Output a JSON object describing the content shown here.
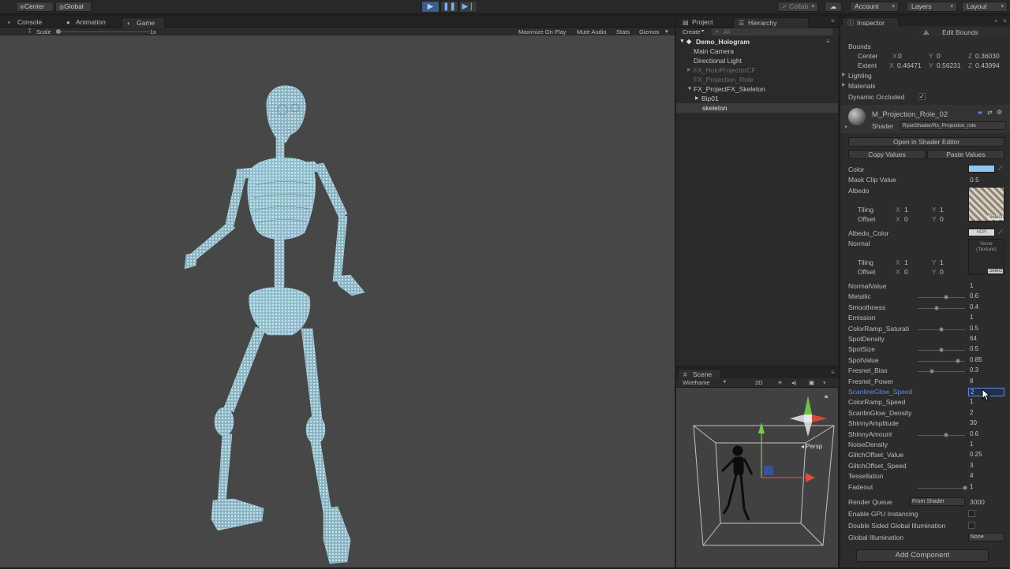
{
  "toolbar": {
    "pivot": "Center",
    "space": "Global",
    "collab": "Collab",
    "account": "Account",
    "layers": "Layers",
    "layout": "Layout"
  },
  "left_tabs": [
    {
      "label": "Console",
      "icon": "console-icon"
    },
    {
      "label": "Animation",
      "icon": "animation-icon"
    },
    {
      "label": "Game",
      "icon": "game-icon"
    }
  ],
  "game": {
    "scale_label": "Scale",
    "scale_value": "1x",
    "maximize": "Maximize On Play",
    "mute": "Mute Audio",
    "stats": "Stats",
    "gizmos": "Gizmos"
  },
  "mid_tabs": [
    {
      "label": "Project",
      "icon": "project-icon"
    },
    {
      "label": "Hierarchy",
      "icon": "hierarchy-icon"
    }
  ],
  "hierarchy": {
    "create": "Create",
    "search_placeholder": "All",
    "scene_name": "Demo_Hologram",
    "items": [
      {
        "label": "Main Camera",
        "dim": false,
        "arrow": ""
      },
      {
        "label": "Directional Light",
        "dim": false,
        "arrow": ""
      },
      {
        "label": "FX_HoloProjectorCF",
        "dim": true,
        "arrow": "▶"
      },
      {
        "label": "FX_Projection_Role",
        "dim": true,
        "arrow": ""
      },
      {
        "label": "FX_ProjectFX_Skeleton",
        "dim": false,
        "arrow": "▼"
      },
      {
        "label": "Bip01",
        "dim": false,
        "arrow": "▶"
      },
      {
        "label": "skeleton",
        "dim": false,
        "arrow": ""
      }
    ]
  },
  "scene": {
    "tab": "Scene",
    "mode": "Wireframe",
    "dim": "2D",
    "persp": "Persp"
  },
  "inspector": {
    "tab": "Inspector",
    "edit_bounds": "Edit Bounds",
    "bounds_label": "Bounds",
    "center_label": "Center",
    "center": {
      "x": "0",
      "y": "0",
      "z": "0.36030"
    },
    "extent_label": "Extent",
    "extent": {
      "x": "0.46471",
      "y": "0.56231",
      "z": "0.43994"
    },
    "lighting": "Lighting",
    "materials": "Materials",
    "dynamic_occluded": "Dynamic Occluded",
    "material_name": "M_Projection_Role_02",
    "shader_label": "Shader",
    "shader_value": "RyanShader/Rs_Projection_role",
    "open_shader_editor": "Open in Shader Editor",
    "copy_values": "Copy Values",
    "paste_values": "Paste Values",
    "color_label": "Color",
    "mask_clip_label": "Mask Clip Value",
    "mask_clip_value": "0.5",
    "albedo_label": "Albedo",
    "tiling_label": "Tiling",
    "offset_label": "Offset",
    "tiling1": {
      "x": "1",
      "y": "1"
    },
    "offset1": {
      "x": "0",
      "y": "0"
    },
    "select": "Select",
    "albedo_color_label": "Albedo_Color",
    "hdr": "HDR",
    "normal_label": "Normal",
    "none_texture": "None (Texture)",
    "tiling2": {
      "x": "1",
      "y": "1"
    },
    "offset2": {
      "x": "0",
      "y": "0"
    },
    "properties": [
      {
        "label": "NormalValue",
        "value": "1",
        "slider": null
      },
      {
        "label": "Metallic",
        "value": "0.6",
        "slider": 0.6
      },
      {
        "label": "Smoothness",
        "value": "0.4",
        "slider": 0.4
      },
      {
        "label": "Emission",
        "value": "1",
        "slider": null
      },
      {
        "label": "ColorRamp_Saturati",
        "value": "0.5",
        "slider": 0.5
      },
      {
        "label": "SpotDensity",
        "value": "64",
        "slider": null
      },
      {
        "label": "SpotSize",
        "value": "0.5",
        "slider": 0.5
      },
      {
        "label": "SpotValue",
        "value": "0.85",
        "slider": 0.85
      },
      {
        "label": "Fresnel_Bias",
        "value": "0.3",
        "slider": 0.3
      },
      {
        "label": "Fresnel_Power",
        "value": "8",
        "slider": null
      },
      {
        "label": "ScanlineGlow_Speed",
        "value": "2",
        "slider": null,
        "active": true
      },
      {
        "label": "ColorRamp_Speed",
        "value": "1",
        "slider": null
      },
      {
        "label": "ScanlinGlow_Density",
        "value": "2",
        "slider": null
      },
      {
        "label": "ShinnyAmplitude",
        "value": "30",
        "slider": null
      },
      {
        "label": "ShinnyAmount",
        "value": "0.6",
        "slider": 0.6
      },
      {
        "label": "NoiseDensity",
        "value": "1",
        "slider": null
      },
      {
        "label": "GlitchOffset_Value",
        "value": "0.25",
        "slider": null
      },
      {
        "label": "GlitchOffset_Speed",
        "value": "3",
        "slider": null
      },
      {
        "label": "Tessellation",
        "value": "4",
        "slider": null
      },
      {
        "label": "Fadeout",
        "value": "1",
        "slider": 1
      }
    ],
    "render_queue_label": "Render Queue",
    "render_queue_mode": "From Shader",
    "render_queue_value": "3000",
    "gpu_instancing": "Enable GPU Instancing",
    "double_sided_gi": "Double Sided Global Illumination",
    "global_illumination": "Global Illumination",
    "gi_value": "None",
    "add_component": "Add Component"
  },
  "colors": {
    "accent": "#3f5b86",
    "active_label": "#5b8de6",
    "color_swatch": "#8ec8f2"
  }
}
